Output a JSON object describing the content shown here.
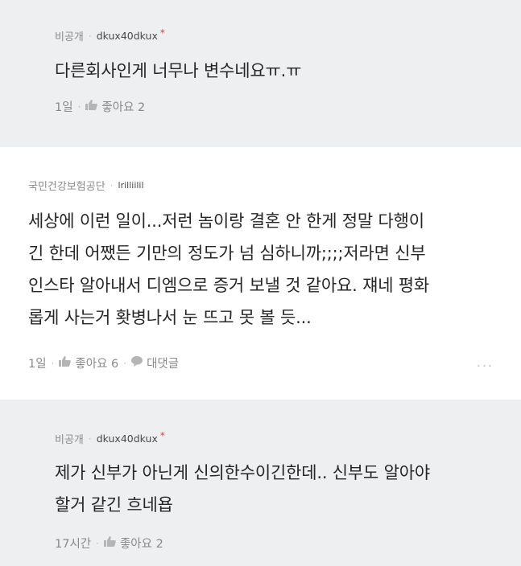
{
  "comments": [
    {
      "author": "비공개",
      "handle": "dkux40dkux",
      "mark": "*",
      "text_lines": [
        "다른회사인게 너무나 변수네요ㅠ.ㅠ"
      ],
      "time": "1일",
      "like_label": "좋아요 2"
    },
    {
      "author": "국민건강보험공단",
      "handle": "lrilliilil",
      "text_lines": [
        "세상에 이런 일이...저런 놈이랑 결혼 안 한게 정말 다행이",
        "긴 한데 어쨌든 기만의 정도가 넘 심하니까;;;;저라면 신부",
        "인스타 알아내서 디엠으로 증거 보낼 것 같아요. 쟤네 평화",
        "롭게 사는거 홧병나서 눈 뜨고 못 볼 듯..."
      ],
      "time": "1일",
      "like_label": "좋아요 6",
      "reply_label": "대댓글",
      "more_label": "..."
    },
    {
      "author": "비공개",
      "handle": "dkux40dkux",
      "mark": "*",
      "text_lines": [
        "제가 신부가 아닌게 신의한수이긴한데.. 신부도 알아야",
        "할거 같긴 흐네욥"
      ],
      "time": "17시간",
      "like_label": "좋아요 2"
    }
  ],
  "colors": {
    "reply_bg": "#eeeff1",
    "mark": "#e23b3b",
    "meta_text": "#8a8a8a"
  },
  "icons": {
    "like": "thumbs-up-icon",
    "reply": "speech-bubble-icon",
    "more": "more-dots-icon"
  }
}
